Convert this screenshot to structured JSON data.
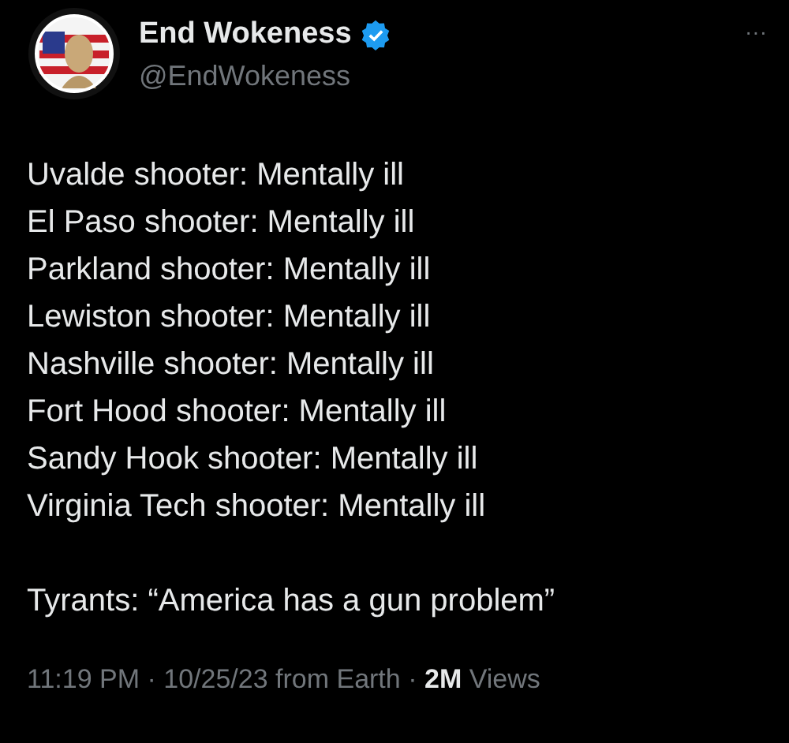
{
  "author": {
    "name": "End Wokeness",
    "verified": true,
    "handle": "@EndWokeness"
  },
  "more_menu": "···",
  "body_lines": [
    "Uvalde shooter: Mentally ill",
    "El Paso shooter: Mentally ill",
    "Parkland shooter: Mentally ill",
    "Lewiston shooter: Mentally ill",
    "Nashville shooter: Mentally ill",
    "Fort Hood shooter: Mentally ill",
    "Sandy Hook shooter: Mentally ill",
    "Virginia Tech shooter: Mentally ill"
  ],
  "closing_line": "Tyrants: “America has a gun problem”",
  "meta": "11:19 PM · 10/25/23 from Earth · **2M** Views"
}
